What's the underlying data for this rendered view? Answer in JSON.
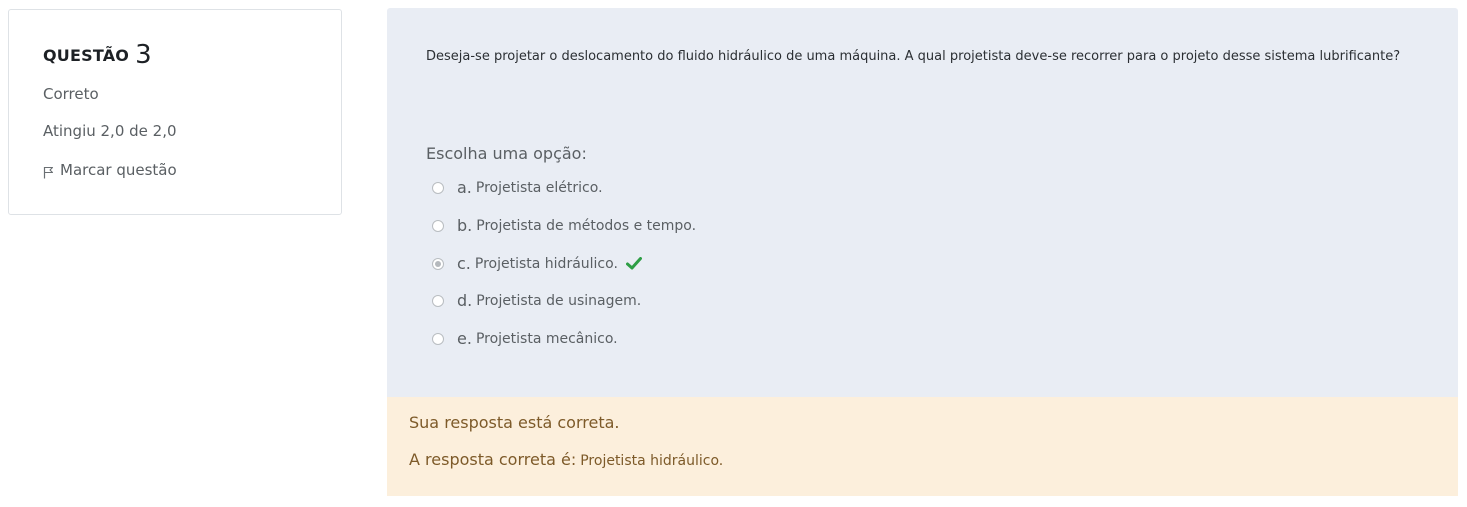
{
  "question_info": {
    "label": "QUESTÃO",
    "number": "3",
    "state": "Correto",
    "grade": "Atingiu 2,0 de 2,0",
    "flag_label": "Marcar questão",
    "flag_icon": "flag-icon"
  },
  "question": {
    "text": "Deseja-se projetar o deslocamento do fluido hidráulico de uma máquina. A qual projetista deve-se recorrer para o projeto desse sistema lubrificante?",
    "prompt": "Escolha uma opção:",
    "options": [
      {
        "letter": "a.",
        "text": "Projetista elétrico.",
        "selected": false
      },
      {
        "letter": "b.",
        "text": "Projetista de métodos e tempo.",
        "selected": false
      },
      {
        "letter": "c.",
        "text": "Projetista hidráulico.",
        "selected": true,
        "correct_icon": "check-icon"
      },
      {
        "letter": "d.",
        "text": "Projetista de usinagem.",
        "selected": false
      },
      {
        "letter": "e.",
        "text": "Projetista mecânico.",
        "selected": false
      }
    ]
  },
  "feedback": {
    "status": "Sua resposta está correta.",
    "correct_label": "A resposta correta é:",
    "correct_answer": "Projetista hidráulico."
  },
  "colors": {
    "formulation_bg": "#e9edf4",
    "feedback_bg": "#fcefdc",
    "feedback_text": "#7d5a29",
    "check_green": "#2e9e45"
  }
}
